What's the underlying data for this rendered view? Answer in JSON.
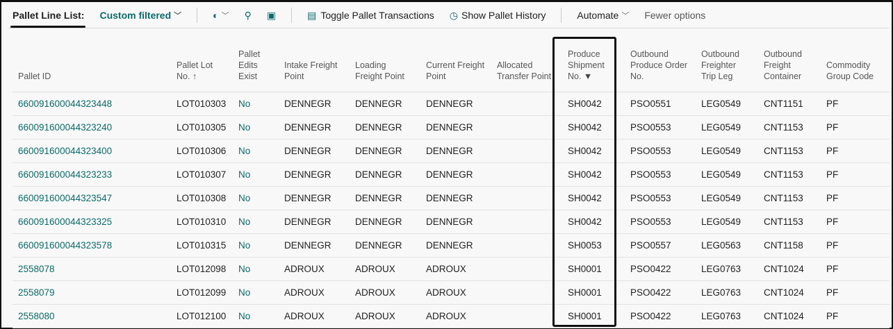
{
  "toolbar": {
    "title": "Pallet Line List:",
    "view": "Custom filtered",
    "toggle": "Toggle Pallet Transactions",
    "history": "Show Pallet History",
    "automate": "Automate",
    "fewer": "Fewer options"
  },
  "columns": [
    "Pallet ID",
    "Pallet Lot No. ↑",
    "Pallet Edits Exist",
    "Intake Freight Point",
    "Loading Freight Point",
    "Current Freight Point",
    "Allocated Transfer Point",
    "Produce Shipment No.",
    "Outbound Produce Order No.",
    "Outbound Freighter Trip Leg",
    "Outbound Freight Container",
    "Commodity Group Code"
  ],
  "rows": [
    [
      "660091600044323448",
      "LOT010303",
      "No",
      "DENNEGR",
      "DENNEGR",
      "DENNEGR",
      "",
      "SH0042",
      "PSO0551",
      "LEG0549",
      "CNT1151",
      "PF"
    ],
    [
      "660091600044323240",
      "LOT010305",
      "No",
      "DENNEGR",
      "DENNEGR",
      "DENNEGR",
      "",
      "SH0042",
      "PSO0553",
      "LEG0549",
      "CNT1153",
      "PF"
    ],
    [
      "660091600044323400",
      "LOT010306",
      "No",
      "DENNEGR",
      "DENNEGR",
      "DENNEGR",
      "",
      "SH0042",
      "PSO0553",
      "LEG0549",
      "CNT1153",
      "PF"
    ],
    [
      "660091600044323233",
      "LOT010307",
      "No",
      "DENNEGR",
      "DENNEGR",
      "DENNEGR",
      "",
      "SH0042",
      "PSO0553",
      "LEG0549",
      "CNT1153",
      "PF"
    ],
    [
      "660091600044323547",
      "LOT010308",
      "No",
      "DENNEGR",
      "DENNEGR",
      "DENNEGR",
      "",
      "SH0042",
      "PSO0553",
      "LEG0549",
      "CNT1153",
      "PF"
    ],
    [
      "660091600044323325",
      "LOT010310",
      "No",
      "DENNEGR",
      "DENNEGR",
      "DENNEGR",
      "",
      "SH0042",
      "PSO0553",
      "LEG0549",
      "CNT1153",
      "PF"
    ],
    [
      "660091600044323578",
      "LOT010315",
      "No",
      "DENNEGR",
      "DENNEGR",
      "DENNEGR",
      "",
      "SH0053",
      "PSO0557",
      "LEG0563",
      "CNT1158",
      "PF"
    ],
    [
      "2558078",
      "LOT012098",
      "No",
      "ADROUX",
      "ADROUX",
      "ADROUX",
      "",
      "SH0001",
      "PSO0422",
      "LEG0763",
      "CNT1024",
      "PF"
    ],
    [
      "2558079",
      "LOT012099",
      "No",
      "ADROUX",
      "ADROUX",
      "ADROUX",
      "",
      "SH0001",
      "PSO0422",
      "LEG0763",
      "CNT1024",
      "PF"
    ],
    [
      "2558080",
      "LOT012100",
      "No",
      "ADROUX",
      "ADROUX",
      "ADROUX",
      "",
      "SH0001",
      "PSO0422",
      "LEG0763",
      "CNT1024",
      "PF"
    ]
  ],
  "accent": "#0b6a6a"
}
